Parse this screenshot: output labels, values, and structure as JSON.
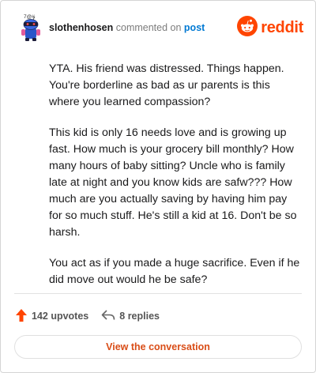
{
  "header": {
    "avatar_icon": "snoo-avatar-icon",
    "avatar_caption": "7@#",
    "username": "slothenhosen",
    "verb": "commented on",
    "post_link": "post",
    "brand_icon": "reddit-logo-icon",
    "brand_word": "reddit",
    "brand_color": "#ff4500"
  },
  "comment": {
    "paragraphs": [
      "YTA. His friend was distressed. Things happen. You're borderline as bad as ur parents is this where you learned compassion?",
      "This kid is only 16 needs love and is growing up fast. How much is your grocery bill monthly? How many hours of baby sitting? Uncle who is family late at night and you know kids are safw??? How much are you actually saving by having him pay for so much stuff. He's still a kid at 16. Don't be so harsh.",
      "You act as if you made a huge sacrifice. Even if he did move out would he be safe?"
    ]
  },
  "stats": {
    "upvotes": "142 upvotes",
    "upvote_icon": "upvote-arrow-icon",
    "replies": "8 replies",
    "reply_icon": "reply-arrow-icon"
  },
  "cta": {
    "label": "View the conversation",
    "color": "#d94d17"
  }
}
